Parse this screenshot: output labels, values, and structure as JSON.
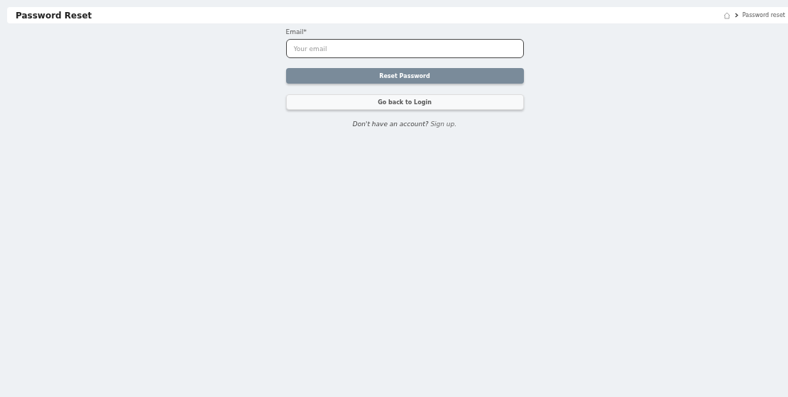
{
  "header": {
    "title": "Password Reset",
    "breadcrumb": [
      {
        "kind": "home"
      },
      {
        "kind": "page",
        "label": "Password reset"
      }
    ]
  },
  "form": {
    "email": {
      "label": "Email*",
      "placeholder": "Your email"
    },
    "primary_button": "Reset Password",
    "secondary_button": "Go back to Login",
    "signup": {
      "prompt": "Don't have an account?",
      "link": "Sign up."
    }
  }
}
